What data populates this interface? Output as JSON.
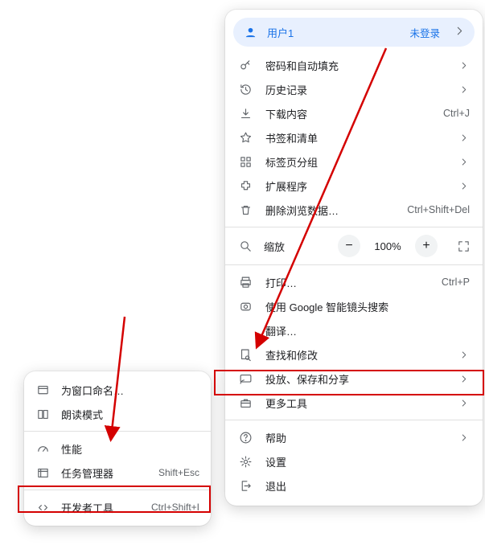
{
  "profile": {
    "label": "用户1",
    "status": "未登录"
  },
  "menu": {
    "passwords": "密码和自动填充",
    "history": "历史记录",
    "downloads": "下载内容",
    "downloads_accel": "Ctrl+J",
    "bookmarks": "书签和清单",
    "tab_groups": "标签页分组",
    "extensions": "扩展程序",
    "clear_data": "删除浏览数据…",
    "clear_data_accel": "Ctrl+Shift+Del",
    "zoom_label": "缩放",
    "zoom_value": "100%",
    "zoom_minus": "−",
    "zoom_plus": "+",
    "print": "打印…",
    "print_accel": "Ctrl+P",
    "lens": "使用 Google 智能镜头搜索",
    "translate": "翻译…",
    "find": "查找和修改",
    "cast": "投放、保存和分享",
    "more_tools": "更多工具",
    "help": "帮助",
    "settings": "设置",
    "exit": "退出"
  },
  "submenu": {
    "name_window": "为窗口命名…",
    "reader_mode": "朗读模式",
    "performance": "性能",
    "task_manager": "任务管理器",
    "task_manager_accel": "Shift+Esc",
    "dev_tools": "开发者工具",
    "dev_tools_accel": "Ctrl+Shift+I"
  }
}
